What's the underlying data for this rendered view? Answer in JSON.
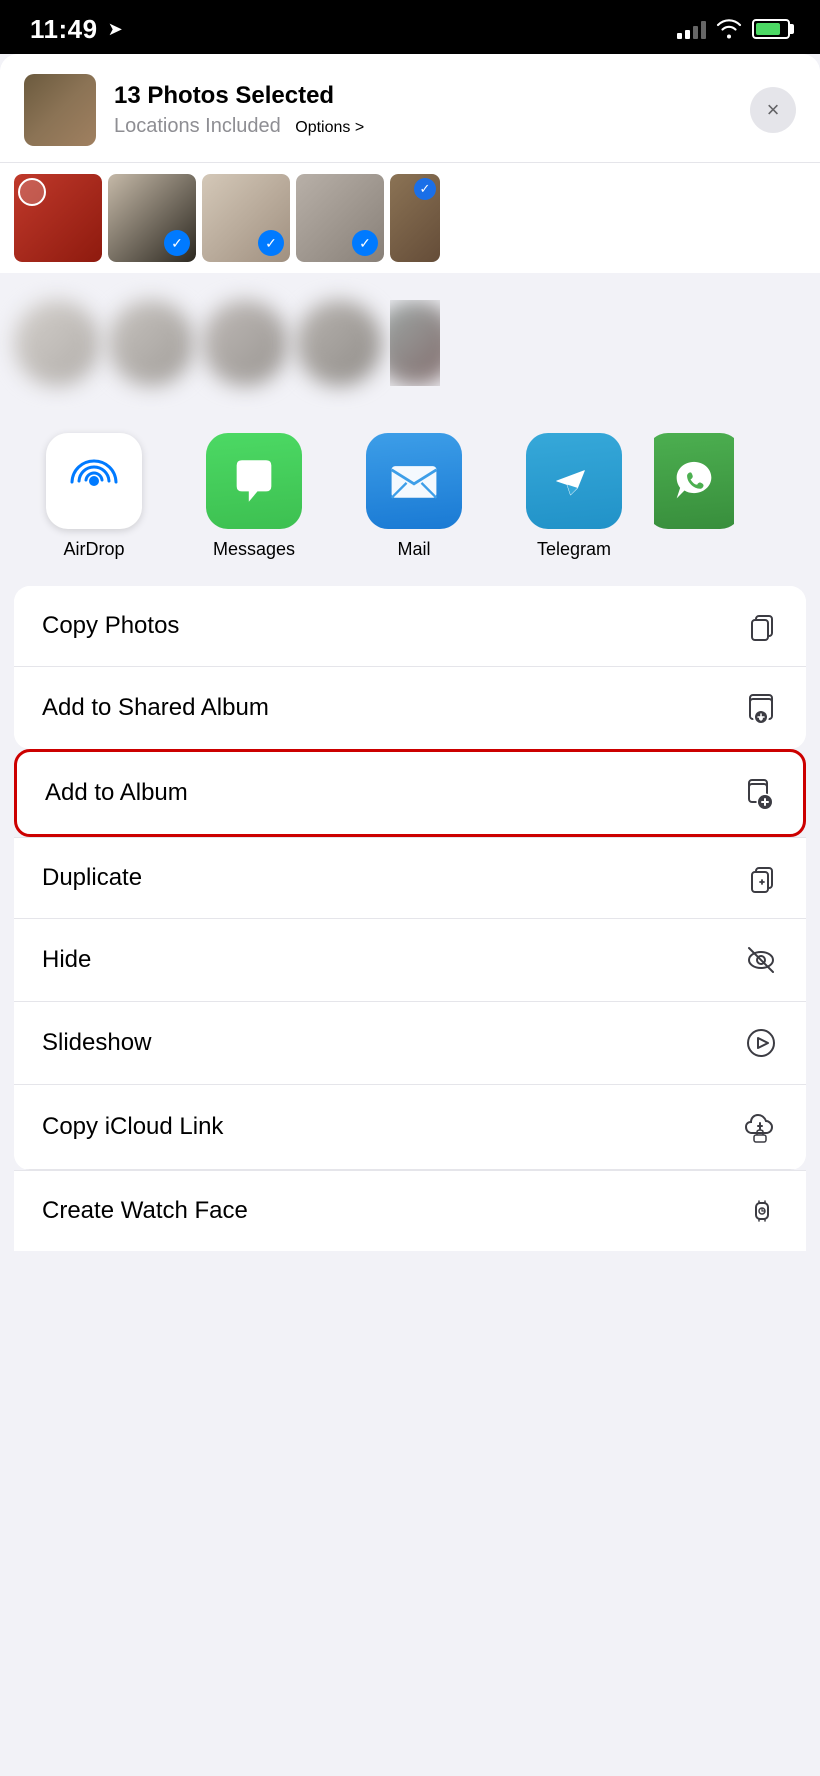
{
  "statusBar": {
    "time": "11:49",
    "locationIcon": "➤"
  },
  "shareHeader": {
    "title": "13 Photos Selected",
    "subtitle": "Locations Included",
    "optionsLabel": "Options >",
    "closeLabel": "×"
  },
  "appIcons": [
    {
      "id": "airdrop",
      "label": "AirDrop",
      "type": "airdrop"
    },
    {
      "id": "messages",
      "label": "Messages",
      "type": "messages"
    },
    {
      "id": "mail",
      "label": "Mail",
      "type": "mail"
    },
    {
      "id": "telegram",
      "label": "Telegram",
      "type": "telegram"
    },
    {
      "id": "whatsapp",
      "label": "Wh…",
      "type": "whatsapp"
    }
  ],
  "actions": [
    {
      "id": "copy-photos",
      "label": "Copy Photos",
      "icon": "copy"
    },
    {
      "id": "add-shared-album",
      "label": "Add to Shared Album",
      "icon": "shared-album"
    },
    {
      "id": "add-album",
      "label": "Add to Album",
      "icon": "add-album",
      "highlighted": true
    },
    {
      "id": "duplicate",
      "label": "Duplicate",
      "icon": "duplicate"
    },
    {
      "id": "hide",
      "label": "Hide",
      "icon": "hide"
    },
    {
      "id": "slideshow",
      "label": "Slideshow",
      "icon": "slideshow"
    },
    {
      "id": "copy-icloud",
      "label": "Copy iCloud Link",
      "icon": "icloud"
    },
    {
      "id": "create-watch-face",
      "label": "Create Watch Face",
      "icon": "watch"
    }
  ]
}
